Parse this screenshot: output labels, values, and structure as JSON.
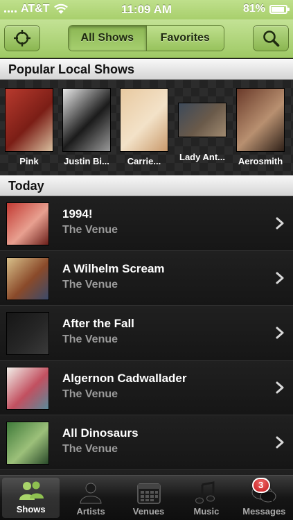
{
  "status_bar": {
    "carrier": "AT&T",
    "time": "11:09 AM",
    "battery": "81%",
    "battery_level": 0.81
  },
  "nav": {
    "segments": [
      {
        "label": "All Shows",
        "selected": true
      },
      {
        "label": "Favorites",
        "selected": false
      }
    ],
    "left_icon": "crosshair-location-icon",
    "right_icon": "search-icon"
  },
  "popular": {
    "header": "Popular Local Shows",
    "artists": [
      {
        "name": "Pink",
        "colors": [
          "#b83a2e",
          "#7b1e16",
          "#d9c0a0"
        ]
      },
      {
        "name": "Justin Bi...",
        "colors": [
          "#e8e8e8",
          "#1b1b1b",
          "#9a9a9a"
        ]
      },
      {
        "name": "Carrie...",
        "colors": [
          "#e8c9a0",
          "#f3e2c8",
          "#c99a6c"
        ]
      },
      {
        "name": "Lady Ant...",
        "colors": [
          "#3d4a5a",
          "#6a5a4a",
          "#a08a70"
        ]
      },
      {
        "name": "Aerosmith",
        "colors": [
          "#6a3a2a",
          "#b89070",
          "#2e2018"
        ]
      }
    ]
  },
  "today": {
    "header": "Today",
    "shows": [
      {
        "title": "1994!",
        "venue": "The Venue",
        "colors": [
          "#c23a33",
          "#e8a090",
          "#6b1f1a"
        ]
      },
      {
        "title": "A Wilhelm Scream",
        "venue": "The Venue",
        "colors": [
          "#d8c08a",
          "#8a4a2a",
          "#3a4a6a"
        ]
      },
      {
        "title": "After the Fall",
        "venue": "The Venue",
        "colors": [
          "#161616",
          "#262626",
          "#3a3a3a"
        ]
      },
      {
        "title": "Algernon Cadwallader",
        "venue": "The Venue",
        "colors": [
          "#f2f0ea",
          "#c25060",
          "#5a8a9a"
        ]
      },
      {
        "title": "All Dinosaurs",
        "venue": "The Venue",
        "colors": [
          "#3f7a3a",
          "#9cc07a",
          "#2a4a2a"
        ]
      }
    ]
  },
  "tabs": [
    {
      "label": "Shows",
      "icon": "people-icon",
      "active": true
    },
    {
      "label": "Artists",
      "icon": "artist-icon",
      "active": false
    },
    {
      "label": "Venues",
      "icon": "calendar-icon",
      "active": false
    },
    {
      "label": "Music",
      "icon": "music-note-icon",
      "active": false
    },
    {
      "label": "Messages",
      "icon": "chat-bubbles-icon",
      "active": false,
      "badge": "3"
    }
  ]
}
